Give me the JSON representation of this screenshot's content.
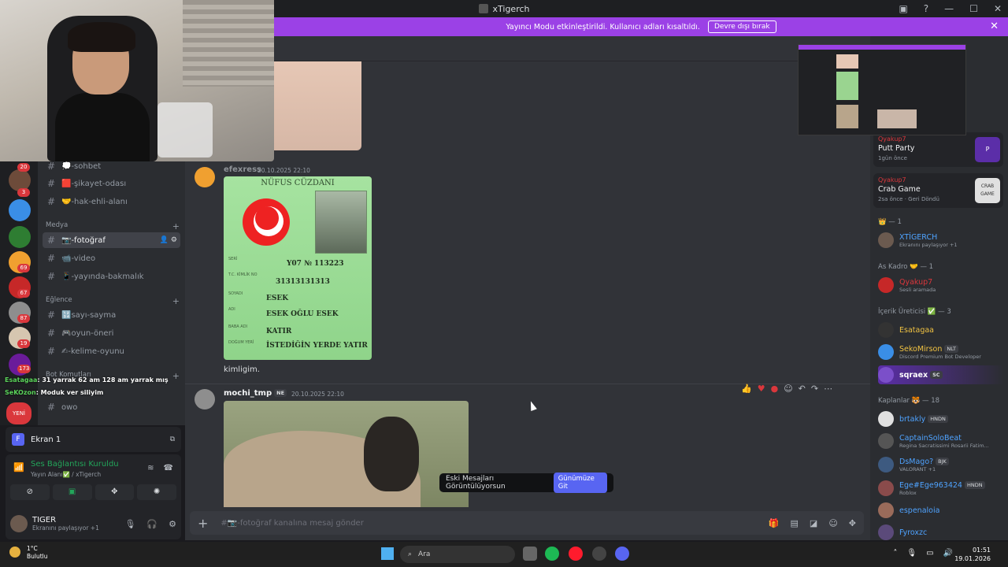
{
  "window": {
    "title": "xTigerch"
  },
  "banner": {
    "text": "Yayıncı Modu etkinleştirildi. Kullanıcı adları kısaltıldı.",
    "button": "Devre dışı bırak",
    "close": "✕"
  },
  "rail": {
    "badges": [
      "20",
      "3",
      "69",
      "67",
      "87",
      "19",
      "173"
    ],
    "new_label": "YENİ"
  },
  "sidebar": {
    "channels_top": [
      {
        "name": "-sohbet",
        "emoji": "💭"
      },
      {
        "name": "-şikayet-odası",
        "emoji": "🟥"
      },
      {
        "name": "-hak-ehli-alanı",
        "emoji": "🤝"
      }
    ],
    "cat_media": "Medya",
    "channels_media": [
      {
        "name": "-fotoğraf",
        "emoji": "📷"
      },
      {
        "name": "-video",
        "emoji": "📹"
      },
      {
        "name": "-yayında-bakmalık",
        "emoji": "📱"
      }
    ],
    "cat_fun": "Eğlence",
    "channels_fun": [
      {
        "name": "sayı-sayma",
        "emoji": "🔢"
      },
      {
        "name": "oyun-öneri",
        "emoji": "🎮"
      },
      {
        "name": "-kelime-oyunu",
        "emoji": "✍"
      }
    ],
    "cat_bot": "Bot Komutları",
    "channel_bot": "owo",
    "overlay_chat": [
      {
        "user": "Esatagaa",
        "text": ": 31 yarrak 62 am 128 am yarrak mış"
      },
      {
        "user": "SeKOzon",
        "text": ": Moduk ver siliyim"
      }
    ]
  },
  "ekran": {
    "label": "Ekran 1",
    "letter": "F"
  },
  "voice": {
    "status": "Ses Bağlantısı Kuruldu",
    "location": "Yayın Alanı✅ / xTigerch"
  },
  "user": {
    "name": "TIGER",
    "status": "Ekranını paylaşıyor +1"
  },
  "chat": {
    "msg1": {
      "author": "efexress",
      "time": "20.10.2025 22:10"
    },
    "idcard": {
      "header": "NÜFUS CÜZDANI",
      "serial": "Y07  № 113223",
      "tc": "31313131313",
      "surname": "ESEK",
      "name": "ESEK OĞLU ESEK",
      "father": "KATIR",
      "birthplace": "İSTEDİĞİN YERDE YATIR",
      "labels": [
        "SERİ",
        "T.C. KİMLİK NO",
        "SOYADI",
        "ADI",
        "BABA ADI",
        "DOĞUM YERİ"
      ]
    },
    "msg1_text": "kimligim.",
    "msg2": {
      "author": "mochi_tmp",
      "tag": "NE",
      "time": "20.10.2025 22:10"
    },
    "jump_text": "Eski Mesajları Görüntülüyorsun",
    "jump_button": "Günümüze Git",
    "composer_placeholder": "#📷-fotoğraf kanalına mesaj gönder"
  },
  "members": {
    "activities": [
      {
        "user": "Qyakup7",
        "game": "Putt Party",
        "when": "1gün önce",
        "thumb": "P"
      },
      {
        "user": "Qyakup7",
        "game": "Crab Game",
        "when": "2sa önce  ·  Geri Döndü",
        "thumb": "CRAB GAME"
      }
    ],
    "groups": [
      {
        "title": "👑 — 1",
        "rows": [
          {
            "name": "XTİGERCH",
            "sub": "Ekranını paylaşıyor +1",
            "color": "#4fa3ff"
          }
        ]
      },
      {
        "title": "As Kadro 🤝 — 1",
        "rows": [
          {
            "name": "Qyakup7",
            "sub": "Sesli aramada",
            "color": "#da373c"
          }
        ]
      },
      {
        "title": "İçerik Üreticisi ✅ — 3",
        "rows": [
          {
            "name": "Esatagaa",
            "sub": "",
            "color": "#f0c242"
          },
          {
            "name": "SekoMirson",
            "sub": "Discord Premium Bot Developer",
            "color": "#f0c242",
            "tag": "NLT"
          },
          {
            "name": "sqraex",
            "sub": "",
            "color": "#ffffff",
            "tag": "SC"
          }
        ]
      },
      {
        "title": "Kaplanlar 🐯 — 18",
        "rows": [
          {
            "name": "brtakly",
            "sub": "",
            "color": "#4fa3ff",
            "tag": "HNDN"
          },
          {
            "name": "CaptainSoloBeat",
            "sub": "Regina Sacratissimi Rosarii Fatim...",
            "color": "#4fa3ff"
          },
          {
            "name": "DsMago?",
            "sub": "VALORANT +1",
            "color": "#4fa3ff",
            "tag": "BJK"
          },
          {
            "name": "Ege#Ege963424",
            "sub": "Roblox",
            "color": "#4fa3ff",
            "tag": "HNDN"
          },
          {
            "name": "espenaloia",
            "sub": "",
            "color": "#4fa3ff"
          },
          {
            "name": "Fyroxzc",
            "sub": "",
            "color": "#4fa3ff"
          }
        ]
      }
    ]
  },
  "taskbar": {
    "weather_temp": "1°C",
    "weather_desc": "Bulutlu",
    "search": "Ara",
    "time": "01:51",
    "date": "19.01.2026"
  }
}
